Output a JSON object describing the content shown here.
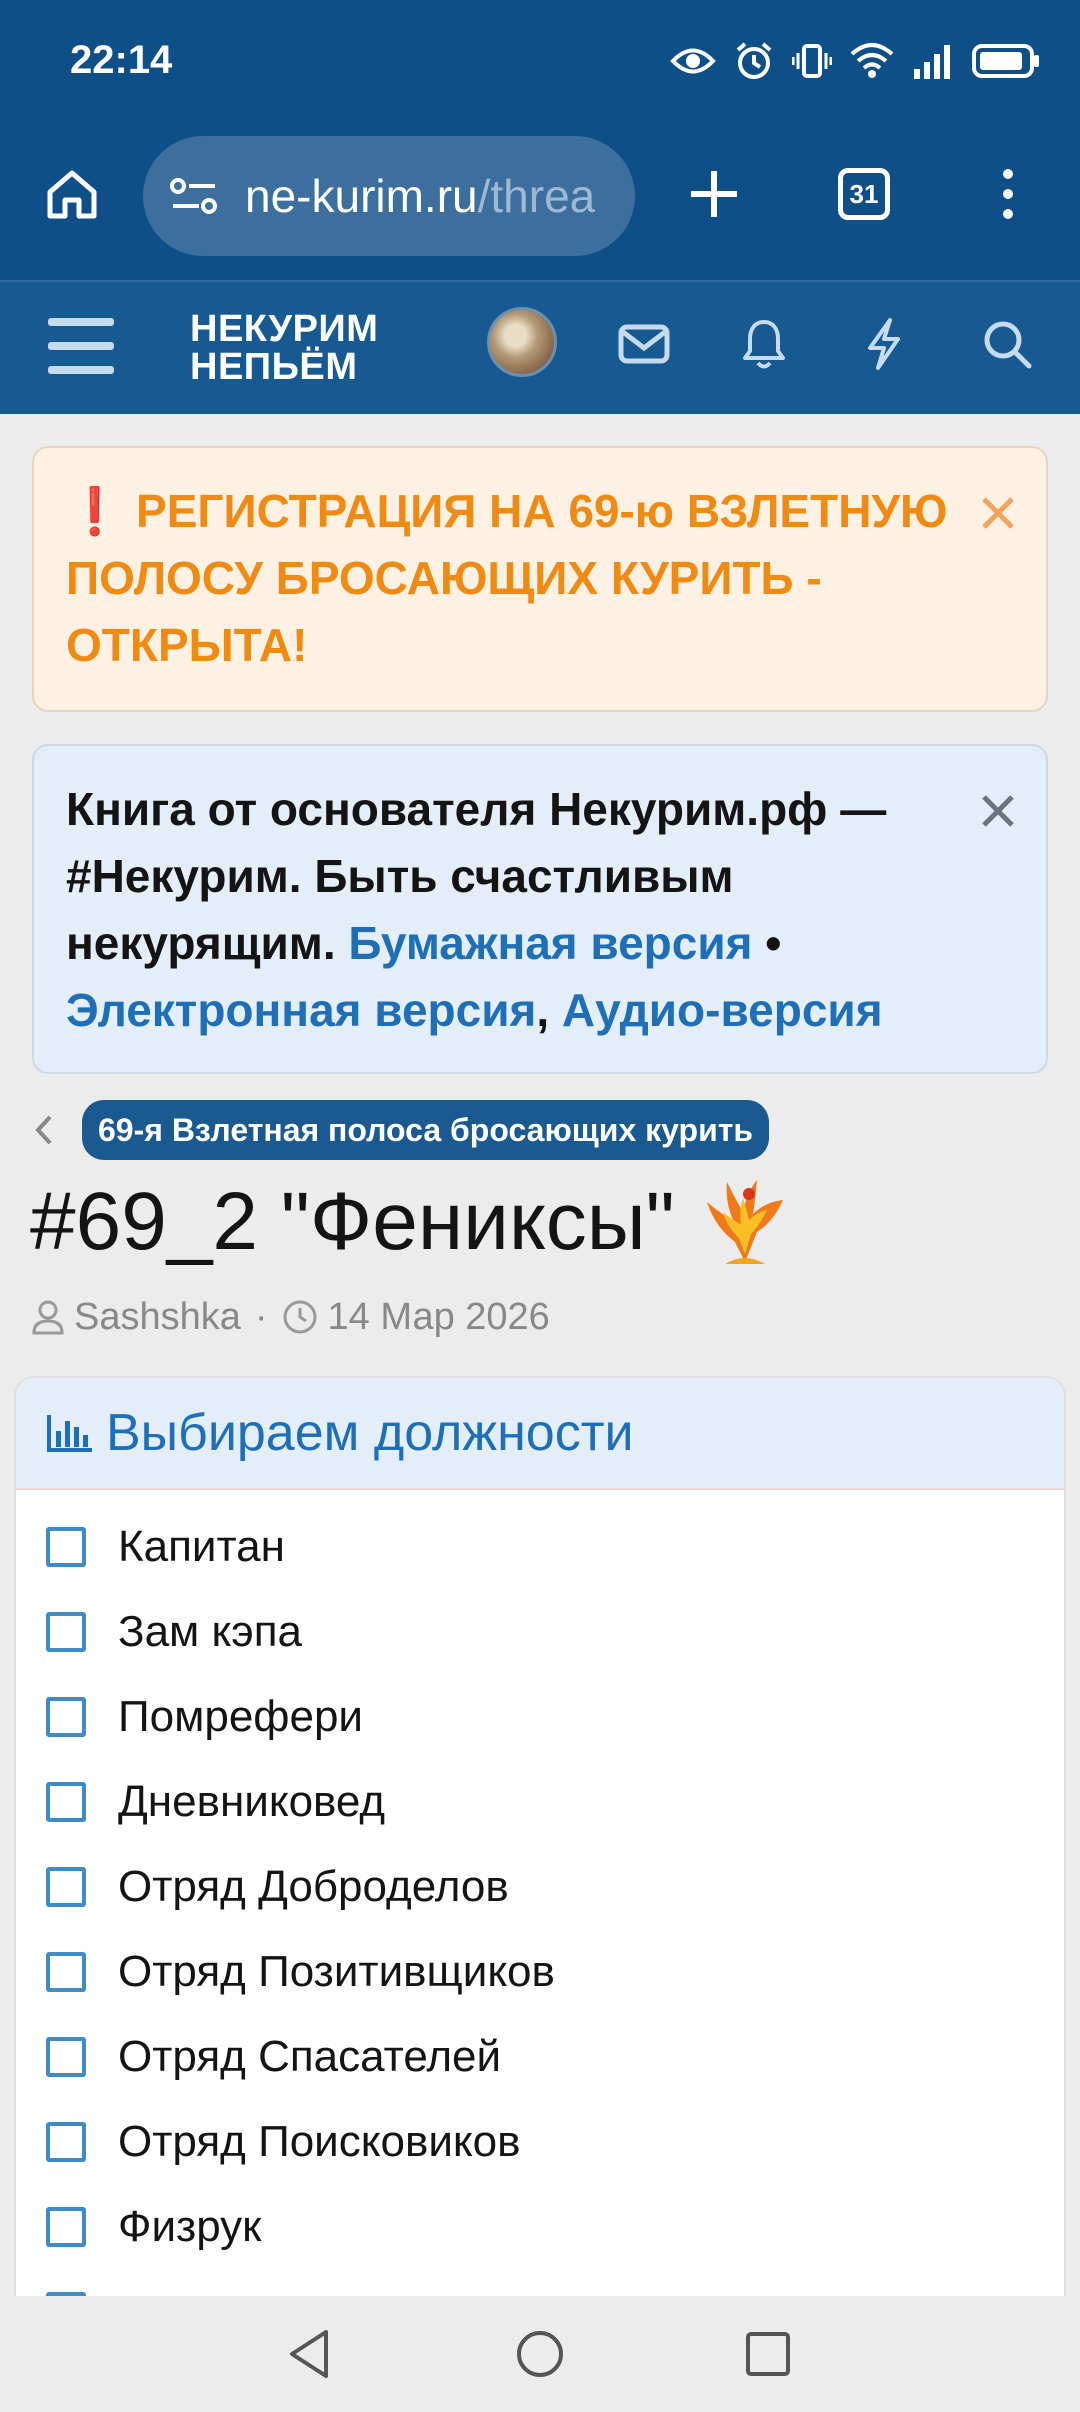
{
  "status_bar": {
    "time": "22:14",
    "icons": [
      "eye-icon",
      "alarm-icon",
      "vibrate-icon",
      "wifi-icon",
      "signal-icon",
      "battery-icon"
    ]
  },
  "browser": {
    "url_main": "ne-kurim.ru",
    "url_rest": "/threa",
    "tab_count": "31",
    "icons": [
      "home-icon",
      "site-info-icon",
      "new-tab-icon",
      "more-icon"
    ]
  },
  "site_header": {
    "logo_line1": "НЕКУРИМ",
    "logo_line2": "НЕПЬЁМ",
    "icons": [
      "menu-icon",
      "mail-icon",
      "bell-icon",
      "lightning-icon",
      "search-icon"
    ]
  },
  "notices": {
    "warning": {
      "icon": "❗",
      "text": " РЕГИСТРАЦИЯ НА 69-ю ВЗЛЕТНУЮ ПОЛОСУ БРОСАЮЩИХ КУРИТЬ - ОТКРЫТА!"
    },
    "info": {
      "text_before": "Книга от основателя Некурим.рф — #Некурим. Быть счастливым некурящим. ",
      "link_paper": "Бумажная версия",
      "sep1": " • ",
      "link_ebook": "Электронная версия",
      "sep2": ", ",
      "link_audio": "Аудио-версия"
    }
  },
  "breadcrumb": {
    "label": "69-я Взлетная полоса бросающих курить"
  },
  "thread": {
    "title": "#69_2 \"Фениксы\"",
    "author": "Sashshka",
    "separator": "·",
    "date": "14 Мар 2026"
  },
  "poll": {
    "title": "Выбираем должности",
    "options": [
      "Капитан",
      "Зам кэпа",
      "Помрефери",
      "Дневниковед",
      "Отряд Доброделов",
      "Отряд Позитивщиков",
      "Отряд Спасателей",
      "Отряд Поисковиков",
      "Физрук"
    ]
  },
  "colors": {
    "header_blue": "#0f4f88",
    "site_header_blue": "#175a92",
    "warning_orange": "#ef8a12",
    "link_blue": "#1f6fb6"
  }
}
